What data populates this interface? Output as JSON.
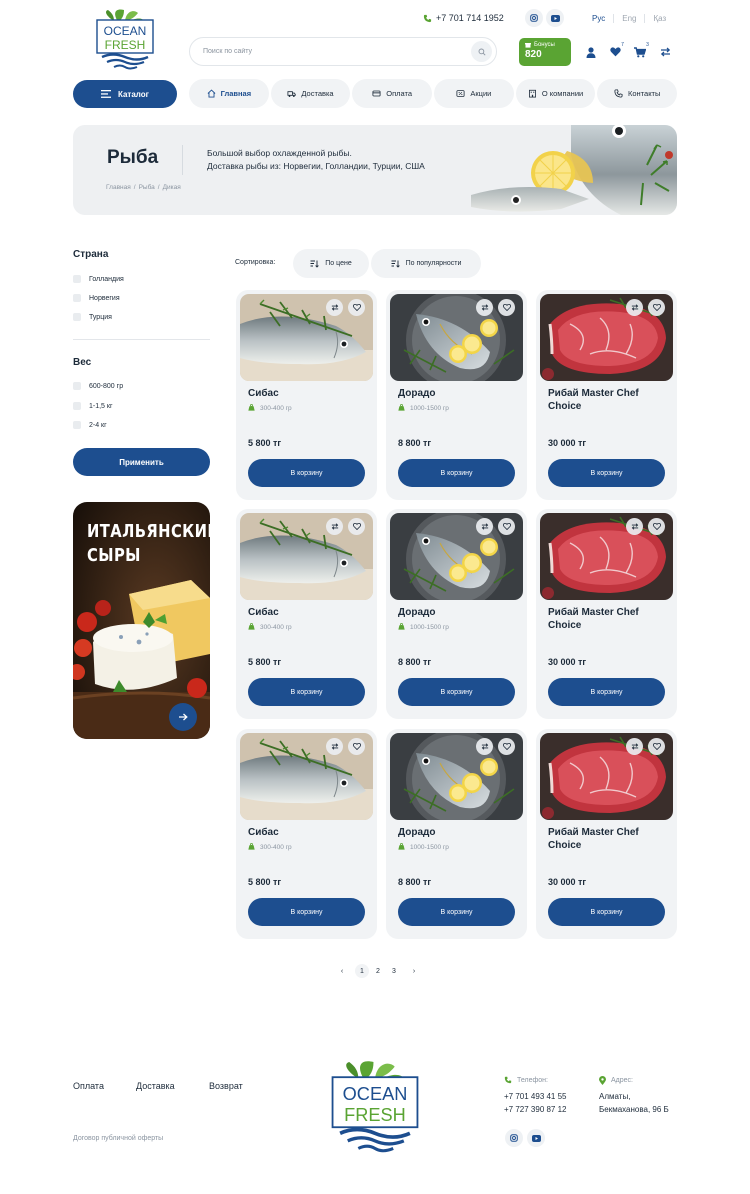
{
  "brand": {
    "logo_line1": "OCEAN",
    "logo_line2": "FRESH"
  },
  "header": {
    "phone": "+7 701 714 1952",
    "languages": [
      "Рус",
      "Eng",
      "Қаз"
    ],
    "search_placeholder": "Поиск по сайту",
    "bonus_label": "Бонусы",
    "bonus_value": "820",
    "favorites_count": "7",
    "cart_count": "3"
  },
  "nav": {
    "catalog_label": "Каталог",
    "items": [
      {
        "label": "Главная",
        "icon": "home-icon"
      },
      {
        "label": "Доставка",
        "icon": "delivery-icon"
      },
      {
        "label": "Оплата",
        "icon": "card-icon"
      },
      {
        "label": "Акции",
        "icon": "percent-icon"
      },
      {
        "label": "О компании",
        "icon": "building-icon"
      },
      {
        "label": "Контакты",
        "icon": "phone-icon"
      }
    ]
  },
  "hero": {
    "title": "Рыба",
    "description_line1": "Большой выбор охлажденной рыбы.",
    "description_line2": "Доставка рыбы из: Норвегии, Голландии, Турции, США",
    "breadcrumbs": [
      "Главная",
      "/",
      "Рыба",
      "/",
      "Дикая"
    ]
  },
  "filters": {
    "country_title": "Страна",
    "countries": [
      "Голландия",
      "Норвегия",
      "Турция"
    ],
    "weight_title": "Вес",
    "weights": [
      "600-800 гр",
      "1-1,5 кг",
      "2-4 кг"
    ],
    "apply_label": "Применить"
  },
  "promo": {
    "title_line1": "ИТАЛЬЯНСКИЕ",
    "title_line2": "СЫРЫ"
  },
  "sorting": {
    "label": "Сортировка:",
    "by_price": "По цене",
    "by_popularity": "По популярности"
  },
  "products": [
    {
      "name": "Сибас",
      "weight": "300-400 гр",
      "price": "5 800 тг",
      "button": "В корзину",
      "image": "seabass"
    },
    {
      "name": "Дорадо",
      "weight": "1000-1500 гр",
      "price": "8 800 тг",
      "button": "В корзину",
      "image": "dorado"
    },
    {
      "name": "Рибай Master Chef Choice",
      "weight": "",
      "price": "30 000 тг",
      "button": "В корзину",
      "image": "ribeye"
    },
    {
      "name": "Сибас",
      "weight": "300-400 гр",
      "price": "5 800 тг",
      "button": "В корзину",
      "image": "seabass"
    },
    {
      "name": "Дорадо",
      "weight": "1000-1500 гр",
      "price": "8 800 тг",
      "button": "В корзину",
      "image": "dorado"
    },
    {
      "name": "Рибай Master Chef Choice",
      "weight": "",
      "price": "30 000 тг",
      "button": "В корзину",
      "image": "ribeye"
    },
    {
      "name": "Сибас",
      "weight": "300-400 гр",
      "price": "5 800 тг",
      "button": "В корзину",
      "image": "seabass"
    },
    {
      "name": "Дорадо",
      "weight": "1000-1500 гр",
      "price": "8 800 тг",
      "button": "В корзину",
      "image": "dorado"
    },
    {
      "name": "Рибай Master Chef Choice",
      "weight": "",
      "price": "30 000 тг",
      "button": "В корзину",
      "image": "ribeye"
    }
  ],
  "pagination": {
    "prev": "‹",
    "pages": [
      "1",
      "2",
      "3"
    ],
    "active": "1",
    "next": "›"
  },
  "footer": {
    "links": [
      "Оплата",
      "Доставка",
      "Возврат"
    ],
    "offer": "Договор публичной оферты",
    "phone_label": "Телефон:",
    "phones": [
      "+7 701 493 41 55",
      "+7 727 390 87 12"
    ],
    "address_label": "Адрес:",
    "address_line1": "Алматы,",
    "address_line2": "Бекмаханова, 96 Б"
  },
  "colors": {
    "primary": "#1d4e8f",
    "accent_green": "#5aa433",
    "surface": "#f1f3f5"
  }
}
